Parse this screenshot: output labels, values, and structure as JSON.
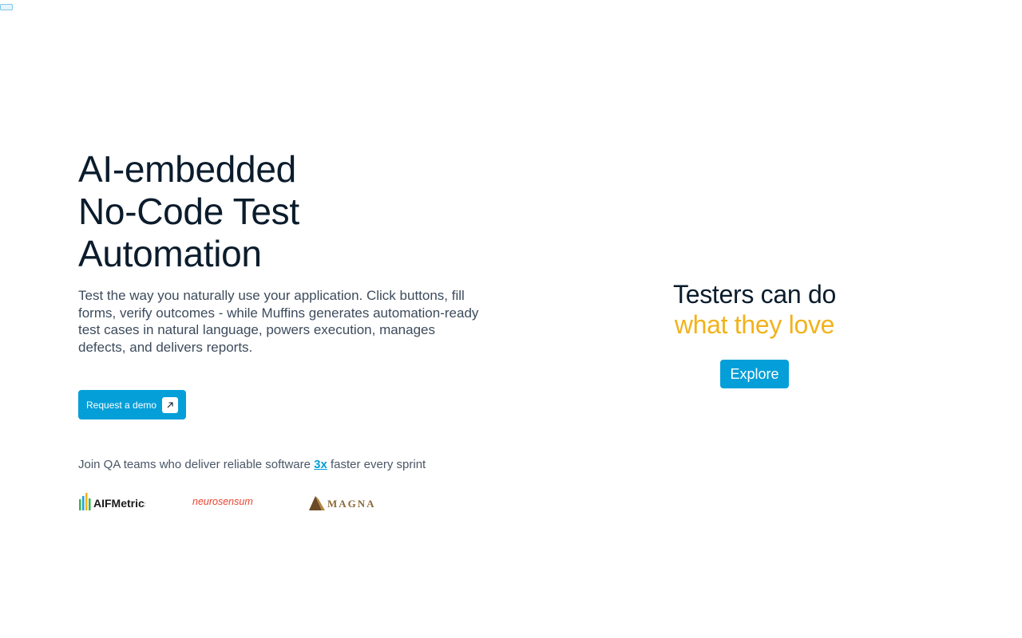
{
  "hero": {
    "headline_lines": [
      "AI-embedded",
      "No-Code Test",
      "Automation"
    ],
    "subtext": "Test the way you naturally use your application. Click buttons, fill forms, verify outcomes - while Muffins generates automation-ready test cases in natural language, powers execution, manages defects, and delivers reports.",
    "cta_label": "Request a demo",
    "cta_icon": "arrow-up-right-icon"
  },
  "social_proof": {
    "prefix": "Join QA teams who deliver reliable software ",
    "highlight": "3x",
    "suffix": " faster every sprint"
  },
  "logos": [
    {
      "name": "AIFMetrics",
      "color": "#1a1a1a"
    },
    {
      "name": "neurosensum",
      "color": "#e8432f"
    },
    {
      "name": "MAGNA",
      "color": "#8a6a3a"
    }
  ],
  "side_panel": {
    "tagline_line1": "Testers can do",
    "tagline_line2": "what they love",
    "button_label": "Explore"
  },
  "colors": {
    "accent": "#049fd9",
    "highlight": "#f2b21c",
    "heading": "#0b1c2c"
  }
}
